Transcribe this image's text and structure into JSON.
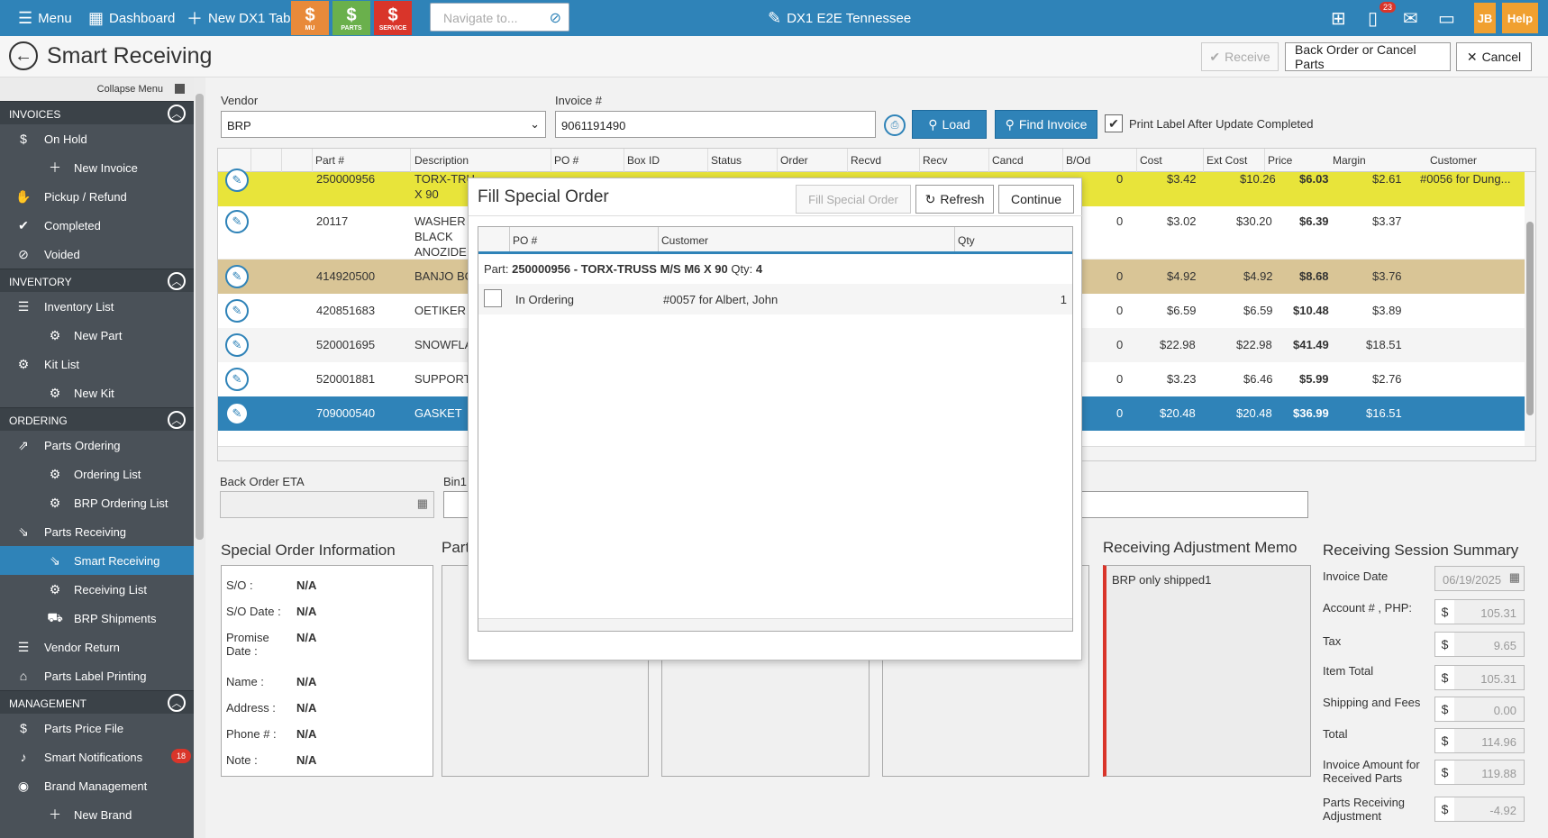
{
  "topbar": {
    "menu": "Menu",
    "dashboard": "Dashboard",
    "new_tab": "New DX1 Tab",
    "quick": [
      {
        "label": "MU",
        "color": "#e88a3a"
      },
      {
        "label": "PARTS",
        "color": "#6ab04c"
      },
      {
        "label": "SERVICE",
        "color": "#d9352a"
      }
    ],
    "navigate_placeholder": "Navigate to...",
    "store": "DX1 E2E Tennessee",
    "notif_count": "23",
    "user": "JB",
    "help": "Help"
  },
  "page": {
    "title": "Smart Receiving",
    "receive": "Receive",
    "backorder": "Back Order or Cancel Parts",
    "cancel": "Cancel"
  },
  "sidebar": {
    "collapse": "Collapse Menu",
    "invoices": {
      "title": "INVOICES",
      "items": [
        "On Hold",
        "New Invoice",
        "Pickup / Refund",
        "Completed",
        "Voided"
      ]
    },
    "inventory": {
      "title": "INVENTORY",
      "items": [
        "Inventory List",
        "New Part",
        "Kit List",
        "New Kit"
      ]
    },
    "ordering": {
      "title": "ORDERING",
      "items": [
        "Parts Ordering",
        "Ordering List",
        "BRP Ordering List",
        "Parts Receiving",
        "Smart Receiving",
        "Receiving List",
        "BRP Shipments",
        "Vendor Return",
        "Parts Label Printing"
      ]
    },
    "management": {
      "title": "MANAGEMENT",
      "items": [
        "Parts Price File",
        "Smart Notifications",
        "Brand Management",
        "New Brand"
      ],
      "notif_badge": "18"
    }
  },
  "form": {
    "vendor_label": "Vendor",
    "vendor_value": "BRP",
    "invoice_label": "Invoice #",
    "invoice_value": "9061191490",
    "load": "Load",
    "find_invoice": "Find Invoice",
    "print_label": "Print Label After Update Completed"
  },
  "grid": {
    "columns": [
      "Part #",
      "Description",
      "PO #",
      "Box ID",
      "Status",
      "Order",
      "Recvd",
      "Recv",
      "Cancd",
      "B/Od",
      "Cost",
      "Ext Cost",
      "Price",
      "Margin",
      "Customer"
    ],
    "rows": [
      {
        "part": "250000956",
        "desc": "TORX-TRU",
        "desc2": "X 90",
        "bod": "0",
        "cost": "$3.42",
        "ext": "$10.26",
        "price": "$6.03",
        "margin": "$2.61",
        "customer": "#0056 for Dung..."
      },
      {
        "part": "20117",
        "desc": "WASHER",
        "desc2": "BLACK",
        "desc3": "ANOZIDE",
        "bod": "0",
        "cost": "$3.02",
        "ext": "$30.20",
        "price": "$6.39",
        "margin": "$3.37",
        "customer": ""
      },
      {
        "part": "414920500",
        "desc": "BANJO BO",
        "bod": "0",
        "cost": "$4.92",
        "ext": "$4.92",
        "price": "$8.68",
        "margin": "$3.76",
        "customer": ""
      },
      {
        "part": "420851683",
        "desc": "OETIKER C",
        "bod": "0",
        "cost": "$6.59",
        "ext": "$6.59",
        "price": "$10.48",
        "margin": "$3.89",
        "customer": ""
      },
      {
        "part": "520001695",
        "desc": "SNOWFLA",
        "bod": "0",
        "cost": "$22.98",
        "ext": "$22.98",
        "price": "$41.49",
        "margin": "$18.51",
        "customer": ""
      },
      {
        "part": "520001881",
        "desc": "SUPPORT",
        "bod": "0",
        "cost": "$3.23",
        "ext": "$6.46",
        "price": "$5.99",
        "margin": "$2.76",
        "customer": ""
      },
      {
        "part": "709000540",
        "desc": "GASKET",
        "bod": "0",
        "cost": "$20.48",
        "ext": "$20.48",
        "price": "$36.99",
        "margin": "$16.51",
        "customer": ""
      }
    ]
  },
  "lower": {
    "back_order_eta": "Back Order ETA",
    "bin1": "Bin1",
    "special_order_title": "Special Order Information",
    "part_title": "Part",
    "memo_title": "Receiving Adjustment Memo",
    "memo_text": "BRP only shipped1",
    "summary_title": "Receiving Session Summary",
    "special": [
      {
        "k": "S/O :",
        "v": "N/A"
      },
      {
        "k": "S/O Date :",
        "v": "N/A"
      },
      {
        "k": "Promise",
        "k2": "Date :",
        "v": "N/A"
      },
      {
        "k": "Name :",
        "v": "N/A"
      },
      {
        "k": "Address :",
        "v": "N/A"
      },
      {
        "k": "Phone # :",
        "v": "N/A"
      },
      {
        "k": "Note :",
        "v": "N/A"
      }
    ],
    "summary": {
      "invoice_date_label": "Invoice Date",
      "invoice_date": "06/19/2025",
      "account_label": "Account # , PHP:",
      "account": "105.31",
      "tax_label": "Tax",
      "tax": "9.65",
      "item_total_label": "Item Total",
      "item_total": "105.31",
      "ship_label": "Shipping and Fees",
      "ship": "0.00",
      "total_label": "Total",
      "total": "114.96",
      "inv_amt_label": "Invoice Amount for",
      "inv_amt_label2": "Received Parts",
      "inv_amt": "119.88",
      "adj_label": "Parts Receiving",
      "adj_label2": "Adjustment",
      "adj": "-4.92",
      "currency": "$"
    }
  },
  "modal": {
    "title": "Fill Special Order",
    "fill": "Fill Special Order",
    "refresh": "Refresh",
    "continue": "Continue",
    "columns": [
      "PO #",
      "Customer",
      "Qty"
    ],
    "part_prefix": "Part:",
    "part_desc": "250000956 - TORX-TRUSS M/S M6 X 90",
    "qty_prefix": "Qty:",
    "qty": "4",
    "row": {
      "status": "In Ordering",
      "customer": "#0057 for Albert, John",
      "qty": "1"
    }
  }
}
